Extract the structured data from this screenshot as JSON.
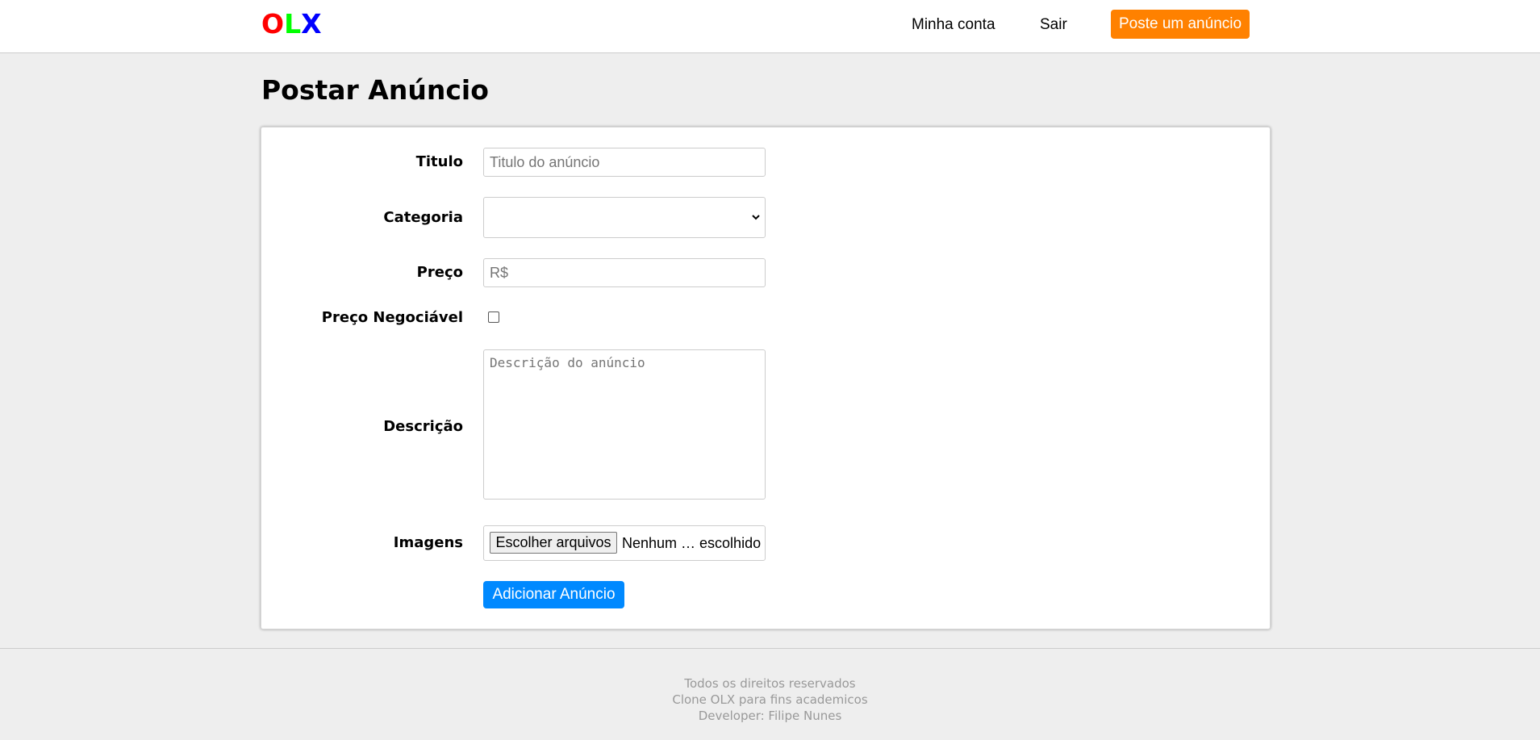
{
  "header": {
    "logo": {
      "o": "O",
      "l": "L",
      "x": "X",
      "colors": [
        "#ff0000",
        "#00ff00",
        "#0000ff"
      ]
    },
    "nav": {
      "account": "Minha conta",
      "logout": "Sair",
      "post_ad": "Poste um anúncio"
    },
    "accent_color": "#ff8100"
  },
  "page": {
    "title": "Postar Anúncio"
  },
  "form": {
    "title": {
      "label": "Titulo",
      "placeholder": "Titulo do anúncio",
      "value": ""
    },
    "category": {
      "label": "Categoria",
      "selected": ""
    },
    "price": {
      "label": "Preço",
      "placeholder": "R$",
      "value": ""
    },
    "negotiable": {
      "label": "Preço Negociável",
      "checked": false
    },
    "description": {
      "label": "Descrição",
      "placeholder": "Descrição do anúncio",
      "value": ""
    },
    "images": {
      "label": "Imagens",
      "button": "Escolher arquivos",
      "status": "Nenhum … escolhido"
    },
    "submit": {
      "label": "Adicionar Anúncio",
      "color": "#0089ff"
    }
  },
  "footer": {
    "lines": [
      "Todos os direitos reservados",
      "Clone OLX para fins academicos",
      "Developer: Filipe Nunes"
    ]
  }
}
